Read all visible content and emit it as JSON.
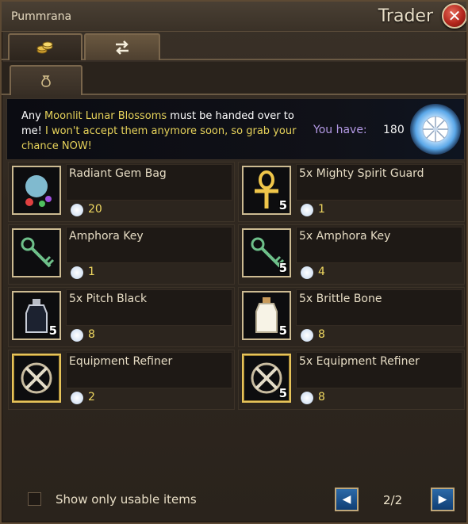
{
  "window": {
    "npc_name": "Pummrana",
    "title": "Trader",
    "close_icon": "close-icon"
  },
  "tabs": {
    "top": [
      {
        "icon": "coins-icon",
        "active": false
      },
      {
        "icon": "exchange-arrows-icon",
        "active": true
      }
    ],
    "sub": [
      {
        "icon": "money-bag-icon",
        "active": true
      }
    ]
  },
  "banner": {
    "text_before": "Any ",
    "highlight1": "Moonlit Lunar Blossoms",
    "text_mid": " must be handed over to me! ",
    "highlight2": "I won't accept them anymore soon, so grab your chance NOW!",
    "you_have_label": "You have:",
    "you_have_count": "180",
    "currency_icon": "lunar-blossom-icon"
  },
  "items": [
    {
      "name": "Radiant Gem Bag",
      "price": "20",
      "stack": "",
      "icon": "gem-bag-icon"
    },
    {
      "name": "5x Mighty Spirit Guard",
      "price": "1",
      "stack": "5",
      "icon": "ankh-icon"
    },
    {
      "name": "Amphora Key",
      "price": "1",
      "stack": "",
      "icon": "key-icon"
    },
    {
      "name": "5x Amphora Key",
      "price": "4",
      "stack": "5",
      "icon": "key-icon"
    },
    {
      "name": "5x Pitch Black",
      "price": "8",
      "stack": "5",
      "icon": "potion-bottle-icon"
    },
    {
      "name": "5x Brittle Bone",
      "price": "8",
      "stack": "5",
      "icon": "bottle-icon"
    },
    {
      "name": "Equipment Refiner",
      "price": "2",
      "stack": "",
      "icon": "refiner-tools-icon"
    },
    {
      "name": "5x Equipment Refiner",
      "price": "8",
      "stack": "5",
      "icon": "refiner-tools-icon"
    }
  ],
  "footer": {
    "checkbox_label": "Show only usable items",
    "checkbox_checked": false,
    "page": "2/2"
  },
  "colors": {
    "highlight": "#e6d25a",
    "you_have": "#b49ae6",
    "price": "#f0d860"
  }
}
